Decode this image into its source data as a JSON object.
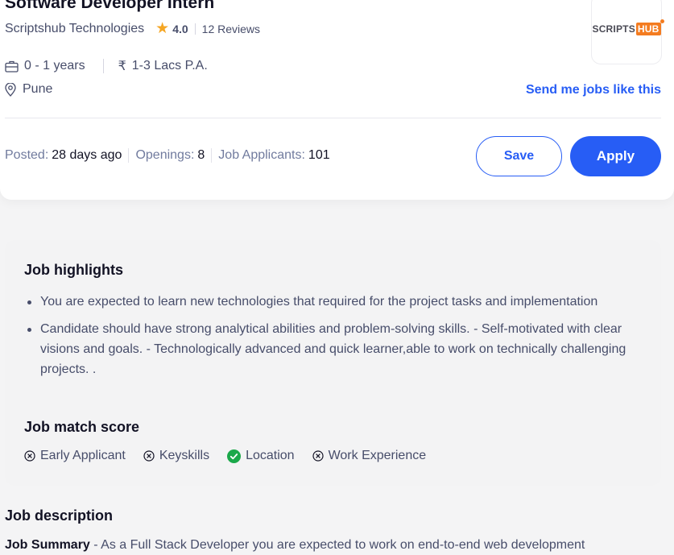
{
  "job": {
    "title": "Software Developer Intern",
    "company": "Scriptshub Technologies",
    "rating": "4.0",
    "reviews": "12 Reviews",
    "logo": {
      "text_a": "SCRIPTS",
      "text_b": "HUB",
      "accent": "#f47c20"
    },
    "experience": "0 - 1 years",
    "salary": "1-3 Lacs P.A.",
    "location": "Pune",
    "send_link": "Send me jobs like this"
  },
  "stats": {
    "posted_label": "Posted:",
    "posted_value": "28 days ago",
    "openings_label": "Openings:",
    "openings_value": "8",
    "applicants_label": "Job Applicants:",
    "applicants_value": "101"
  },
  "actions": {
    "save": "Save",
    "apply": "Apply",
    "accent": "#275df5"
  },
  "highlights": {
    "title": "Job highlights",
    "items": [
      "You are expected to learn new technologies that required for the project tasks and implementation",
      "Candidate should have strong analytical abilities and problem-solving skills. - Self-motivated with clear visions and goals. - Technologically advanced and quick learner,able to work on technically challenging projects. ."
    ]
  },
  "match": {
    "title": "Job match score",
    "items": [
      {
        "label": "Early Applicant",
        "icon": "cross-circle-icon",
        "matched": false
      },
      {
        "label": "Keyskills",
        "icon": "cross-circle-icon",
        "matched": false
      },
      {
        "label": "Location",
        "icon": "check-circle-icon",
        "matched": true
      },
      {
        "label": "Work Experience",
        "icon": "cross-circle-icon",
        "matched": false
      }
    ]
  },
  "description": {
    "title": "Job description",
    "summary_label": "Job Summary",
    "summary_text": " - As a Full Stack Developer you are expected to work on end-to-end web development"
  }
}
